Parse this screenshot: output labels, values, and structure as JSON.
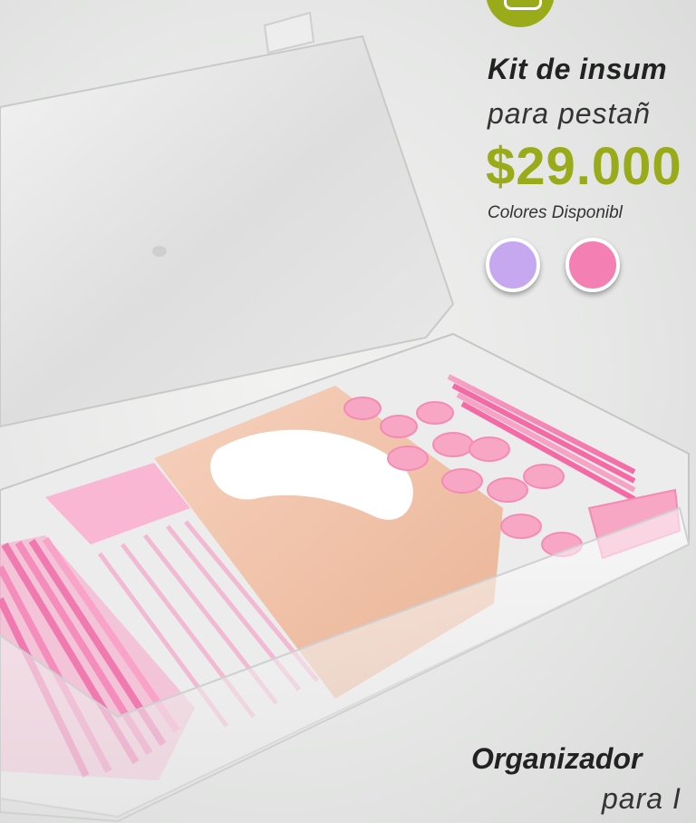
{
  "header": {
    "badge_icon": "bag-icon",
    "title_line1": "Kit de insum",
    "title_line2": "para pestañ",
    "price": "$29.000",
    "colors_label": "Colores Disponibl"
  },
  "colors": {
    "accent": "#9aab1a",
    "swatches": [
      "#c6a8f0",
      "#f47fb3"
    ]
  },
  "footer": {
    "line1": "Organizador",
    "line2": "para I"
  }
}
